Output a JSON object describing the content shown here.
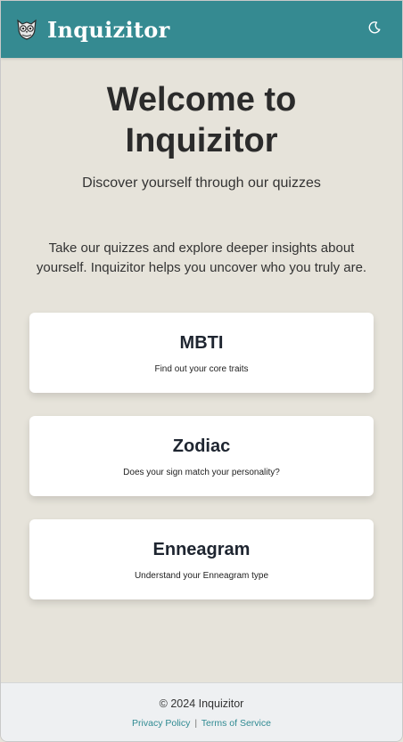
{
  "header": {
    "brand_name": "Inquizitor",
    "logo_icon": "owl-icon",
    "theme_toggle_icon": "moon-icon"
  },
  "hero": {
    "title": "Welcome to Inquizitor",
    "subtitle": "Discover yourself through our quizzes",
    "intro": "Take our quizzes and explore deeper insights about yourself. Inquizitor helps you uncover who you truly are."
  },
  "quizzes": [
    {
      "title": "MBTI",
      "description": "Find out your core traits"
    },
    {
      "title": "Zodiac",
      "description": "Does your sign match your personality?"
    },
    {
      "title": "Enneagram",
      "description": "Understand your Enneagram type"
    }
  ],
  "footer": {
    "copyright": "© 2024 Inquizitor",
    "privacy_label": "Privacy Policy",
    "separator": "|",
    "terms_label": "Terms of Service"
  },
  "colors": {
    "header_bg": "#358a91",
    "page_bg": "#e6e3da",
    "link": "#2f8a92"
  }
}
